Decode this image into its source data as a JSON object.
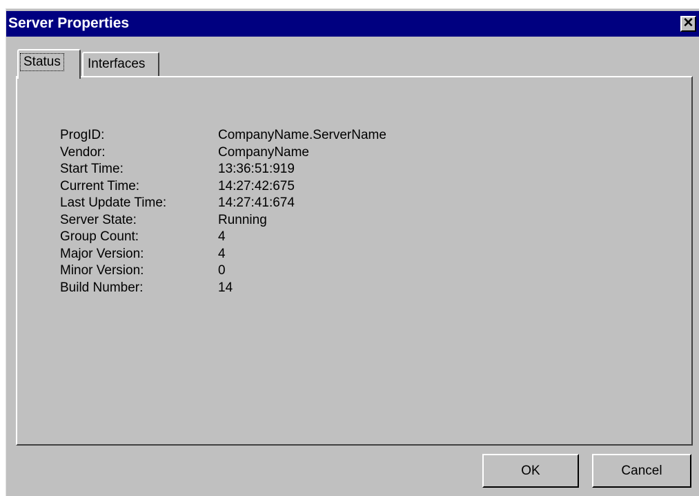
{
  "window": {
    "title": "Server Properties",
    "close_glyph": "✕",
    "close_icon": "close-icon"
  },
  "tabs": [
    {
      "label": "Status",
      "selected": true
    },
    {
      "label": "Interfaces",
      "selected": false
    }
  ],
  "properties": [
    {
      "label": "ProgID:",
      "value": "CompanyName.ServerName"
    },
    {
      "label": "Vendor:",
      "value": "CompanyName"
    },
    {
      "label": "Start Time:",
      "value": "13:36:51:919"
    },
    {
      "label": "Current Time:",
      "value": "14:27:42:675"
    },
    {
      "label": "Last Update Time:",
      "value": "14:27:41:674"
    },
    {
      "label": "Server State:",
      "value": "Running"
    },
    {
      "label": "Group Count:",
      "value": "4"
    },
    {
      "label": "Major Version:",
      "value": "4"
    },
    {
      "label": "Minor Version:",
      "value": "0"
    },
    {
      "label": "Build Number:",
      "value": "14"
    }
  ],
  "buttons": {
    "ok_label": "OK",
    "cancel_label": "Cancel"
  },
  "colors": {
    "titlebar": "#000080",
    "face": "#c0c0c0"
  }
}
